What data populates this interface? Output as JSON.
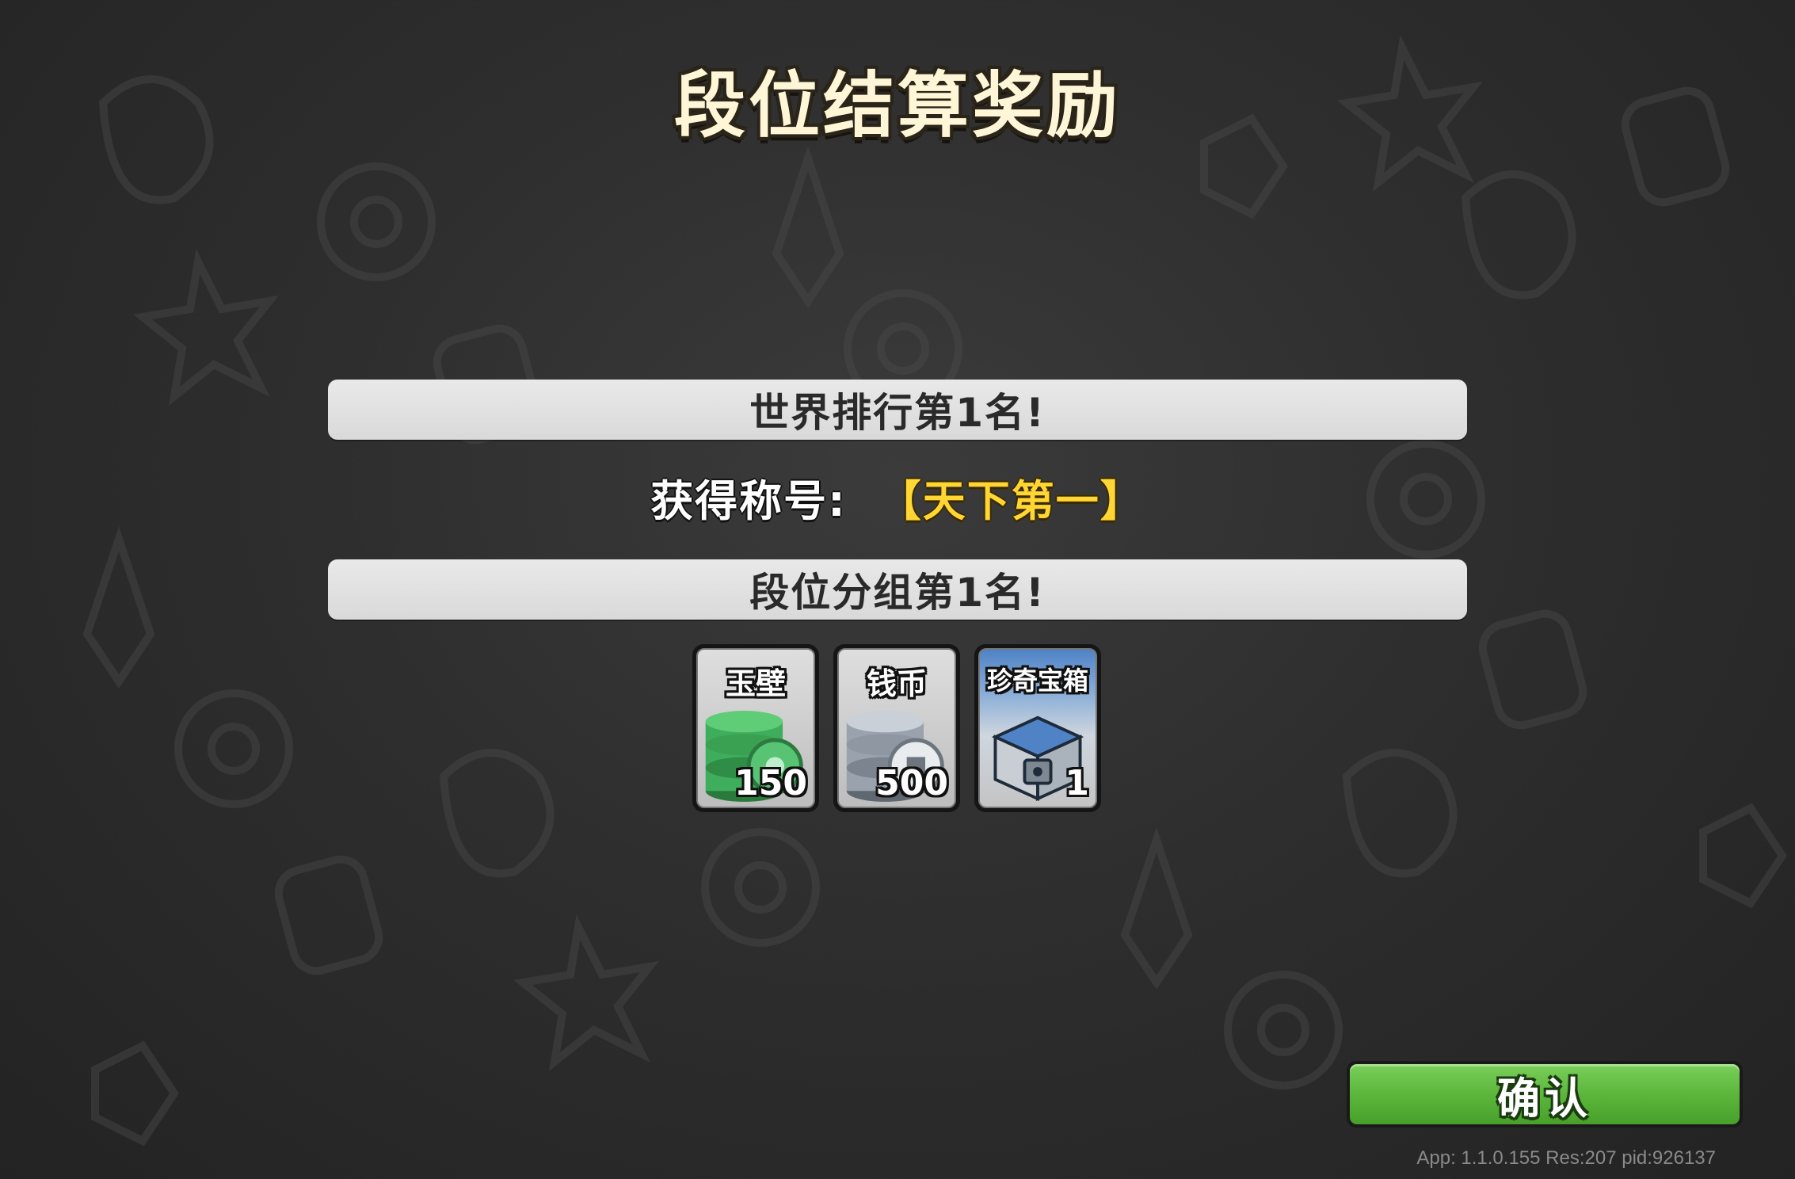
{
  "header": {
    "title": "段位结算奖励"
  },
  "ranking": {
    "world_rank_text": "世界排行第1名!",
    "title_award_label": "获得称号:",
    "title_award_value": "【天下第一】",
    "group_rank_text": "段位分组第1名!"
  },
  "rewards": [
    {
      "name": "玉壁",
      "count": "150",
      "icon": "jade-disc-stack-icon",
      "color": "#3fae5c"
    },
    {
      "name": "钱币",
      "count": "500",
      "icon": "silver-coin-stack-icon",
      "color": "#9aa3ad"
    },
    {
      "name": "珍奇宝箱",
      "count": "1",
      "icon": "treasure-chest-icon",
      "color": "#4f83c6"
    }
  ],
  "footer": {
    "confirm_label": "确认",
    "version_text": "App: 1.1.0.155 Res:207 pid:926137"
  },
  "colors": {
    "title_gold": "#ffe9a6",
    "award_yellow": "#ffd633",
    "confirm_green": "#5cb63c"
  }
}
